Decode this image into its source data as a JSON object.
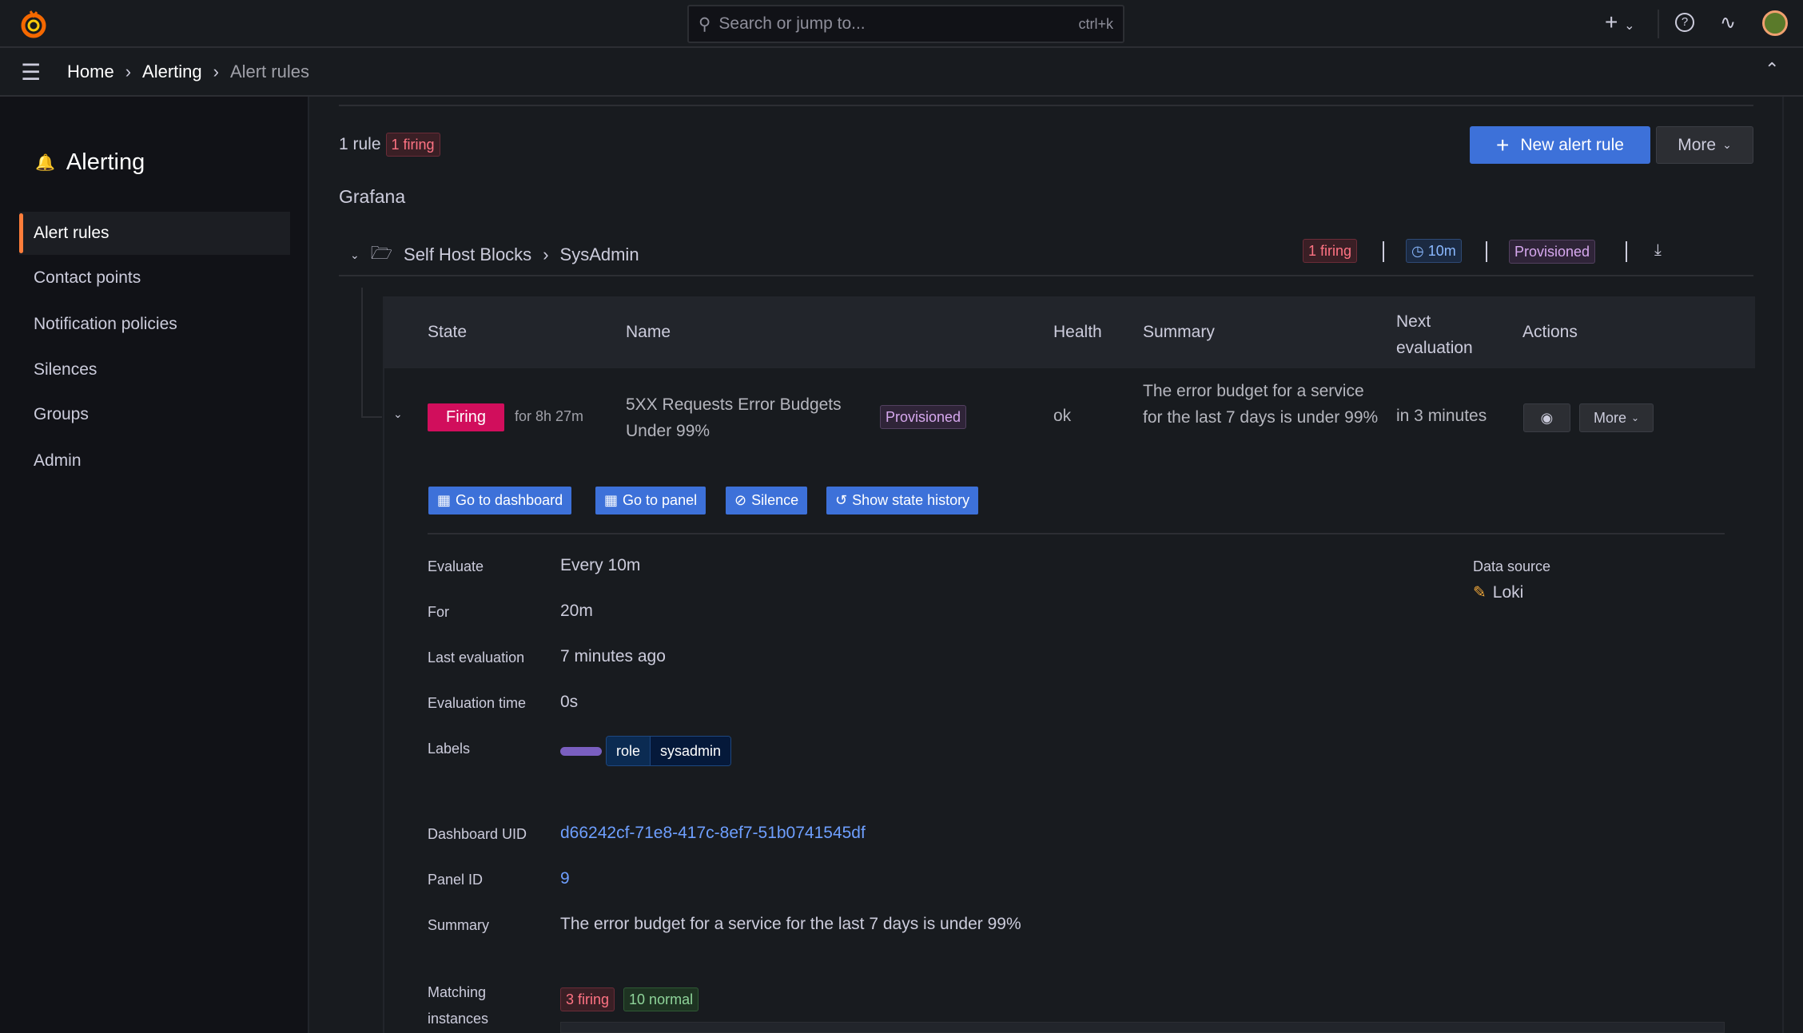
{
  "topbar": {
    "search_placeholder": "Search or jump to...",
    "search_shortcut": "ctrl+k"
  },
  "breadcrumb": [
    "Home",
    "Alerting",
    "Alert rules"
  ],
  "sidebar": {
    "title": "Alerting",
    "items": [
      {
        "label": "Alert rules",
        "active": true
      },
      {
        "label": "Contact points"
      },
      {
        "label": "Notification policies"
      },
      {
        "label": "Silences"
      },
      {
        "label": "Groups"
      },
      {
        "label": "Admin"
      }
    ]
  },
  "summary": {
    "rules": "1 rule",
    "firing": "1 firing"
  },
  "actions": {
    "new_rule": "New alert rule",
    "more": "More"
  },
  "source": "Grafana",
  "folder": {
    "name": "Self Host Blocks",
    "group": "SysAdmin",
    "firing": "1 firing",
    "interval": "10m",
    "provisioned": "Provisioned"
  },
  "table": {
    "headers": [
      "State",
      "Name",
      "Health",
      "Summary",
      "Next evaluation",
      "Actions"
    ],
    "row": {
      "state": "Firing",
      "duration": "for 8h 27m",
      "name": "5XX Requests Error Budgets Under 99%",
      "provisioned": "Provisioned",
      "health": "ok",
      "summary": "The error budget for a service for the last 7 days is under 99%",
      "next": "in 3 minutes",
      "more": "More"
    }
  },
  "row_actions": [
    "Go to dashboard",
    "Go to panel",
    "Silence",
    "Show state history"
  ],
  "details": {
    "evaluate_label": "Evaluate",
    "evaluate": "Every 10m",
    "for_label": "For",
    "for": "20m",
    "last_label": "Last evaluation",
    "last": "7 minutes ago",
    "time_label": "Evaluation time",
    "time": "0s",
    "labels_label": "Labels",
    "label_key": "role",
    "label_value": "sysadmin",
    "uid_label": "Dashboard UID",
    "uid": "d66242cf-71e8-417c-8ef7-51b0741545df",
    "panel_label": "Panel ID",
    "panel": "9",
    "summary_label": "Summary",
    "summary": "The error budget for a service for the last 7 days is under 99%",
    "matching_label": "Matching instances",
    "matching_firing": "3 firing",
    "matching_normal": "10 normal",
    "ds_label": "Data source",
    "ds": "Loki"
  },
  "colors": {
    "firing": "#d10e5c",
    "primary": "#3d71d9",
    "accent": "#ff7d3a",
    "link": "#6e9fff"
  }
}
